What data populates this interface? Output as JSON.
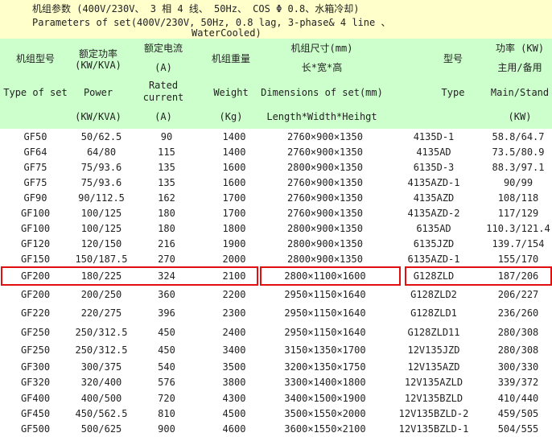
{
  "params": {
    "line1": "机组参数 (400V/230V、 3 相 4 线、 50Hz、 COS Φ 0.8、水箱冷却)",
    "line2": "Parameters of set(400V/230V, 50Hz, 0.8 lag, 3-phase& 4 line 、",
    "line3": "WaterCooled)"
  },
  "header": {
    "type_zh": "机组型号",
    "power_zh": "额定功率",
    "power_unit_top": "(KW/KVA)",
    "current_zh": "额定电流",
    "current_unit_top": "(A)",
    "weight_zh": "机组重量",
    "dim_zh": "机组尺寸(mm)",
    "dim_zh2": "长*宽*高",
    "model_zh": "型号",
    "kw_zh": "功率 (KW)",
    "kw_zh2": "主用/备用",
    "type_en": "Type of set",
    "power_en": "Power",
    "current_en1": "Rated",
    "current_en2": "current",
    "weight_en": "Weight",
    "dim_en": "Dimensions of set(mm)",
    "model_en": "Type",
    "kw_en": "Main/Stand",
    "power_unit": "(KW/KVA)",
    "current_unit": "(A)",
    "weight_unit": "(Kg)",
    "dim_en2": "Length*Width*Heihgt",
    "kw_unit": "(KW)"
  },
  "rows": [
    [
      "GF50",
      "50/62.5",
      "90",
      "1400",
      "2760×900×1350",
      "4135D-1",
      "58.8/64.7"
    ],
    [
      "GF64",
      "64/80",
      "115",
      "1400",
      "2760×900×1350",
      "4135AD",
      "73.5/80.9"
    ],
    [
      "GF75",
      "75/93.6",
      "135",
      "1600",
      "2800×900×1350",
      "6135D-3",
      "88.3/97.1"
    ],
    [
      "GF75",
      "75/93.6",
      "135",
      "1600",
      "2760×900×1350",
      "4135AZD-1",
      "90/99"
    ],
    [
      "GF90",
      "90/112.5",
      "162",
      "1700",
      "2760×900×1350",
      "4135AZD",
      "108/118"
    ],
    [
      "GF100",
      "100/125",
      "180",
      "1700",
      "2760×900×1350",
      "4135AZD-2",
      "117/129"
    ],
    [
      "GF100",
      "100/125",
      "180",
      "1800",
      "2800×900×1350",
      "6135AD",
      "110.3/121.4"
    ],
    [
      "GF120",
      "120/150",
      "216",
      "1900",
      "2800×900×1350",
      "6135JZD",
      "139.7/154"
    ],
    [
      "GF150",
      "150/187.5",
      "270",
      "2000",
      "2800×900×1350",
      "6135AZD-1",
      "155/170"
    ],
    [
      "GF200",
      "180/225",
      "324",
      "2100",
      "2800×1100×1600",
      "G128ZLD",
      "187/206"
    ],
    [
      "GF200",
      "200/250",
      "360",
      "2200",
      "2950×1150×1640",
      "G128ZLD2",
      "206/227"
    ],
    [
      "GF220",
      "220/275",
      "396",
      "2300",
      "2950×1150×1640",
      "G128ZLD1",
      "236/260"
    ],
    [
      "GF250",
      "250/312.5",
      "450",
      "2400",
      "2950×1150×1640",
      "G128ZLD11",
      "280/308"
    ],
    [
      "GF250",
      "250/312.5",
      "450",
      "3400",
      "3150×1350×1700",
      "12V135JZD",
      "280/308"
    ],
    [
      "GF300",
      "300/375",
      "540",
      "3500",
      "3200×1350×1750",
      "12V135AZD",
      "300/330"
    ],
    [
      "GF320",
      "320/400",
      "576",
      "3800",
      "3300×1400×1800",
      "12V135AZLD",
      "339/372"
    ],
    [
      "GF400",
      "400/500",
      "720",
      "4300",
      "3400×1500×1900",
      "12V135BZLD",
      "410/440"
    ],
    [
      "GF450",
      "450/562.5",
      "810",
      "4500",
      "3500×1550×2000",
      "12V135BZLD-2",
      "459/505"
    ],
    [
      "GF500",
      "500/625",
      "900",
      "4600",
      "3600×1550×2100",
      "12V135BZLD-1",
      "504/555"
    ]
  ],
  "highlight_row": 9
}
